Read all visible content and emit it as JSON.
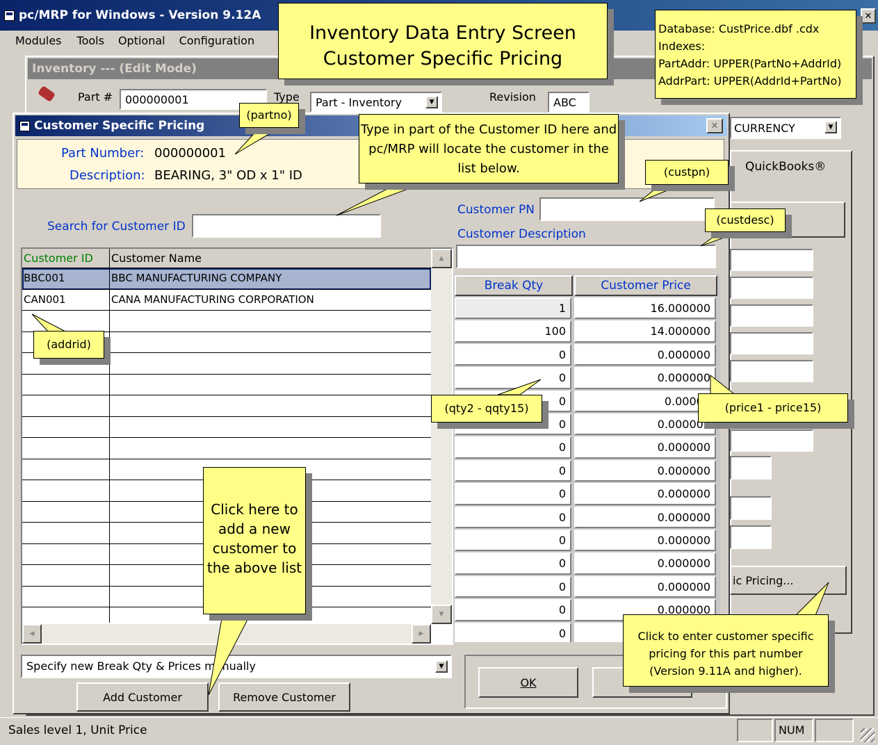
{
  "window": {
    "title": "pc/MRP for Windows - Version 9.12A"
  },
  "menu": [
    "Modules",
    "Tools",
    "Optional",
    "Configuration"
  ],
  "inventory": {
    "title": "Inventory --- (Edit Mode)",
    "part_label": "Part #",
    "part_value": "000000001",
    "type_label": "Type",
    "type_value": "Part - Inventory",
    "revision_label": "Revision",
    "revision_value": "ABC",
    "currency_value": "CURRENCY",
    "quickbooks_tab": "QuickBooks®",
    "pricing_button": "ic Pricing..."
  },
  "dialog": {
    "title": "Customer Specific Pricing",
    "part_number_label": "Part Number:",
    "part_number_value": "000000001",
    "description_label": "Description:",
    "description_value": "BEARING, 3\" OD x 1\" ID",
    "search_label": "Search for Customer ID",
    "search_value": "",
    "customer_pn_label": "Customer PN",
    "customer_pn_value": "",
    "customer_desc_label": "Customer Description",
    "customer_desc_value": "",
    "grid_headers": [
      "Customer ID",
      "Customer Name"
    ],
    "customers": [
      {
        "id": "BBC001",
        "name": "BBC MANUFACTURING COMPANY"
      },
      {
        "id": "CAN001",
        "name": "CANA MANUFACTURING CORPORATION"
      }
    ],
    "price_headers": [
      "Break Qty",
      "Customer Price"
    ],
    "price_rows": [
      {
        "qty": "1",
        "price": "16.000000"
      },
      {
        "qty": "100",
        "price": "14.000000"
      },
      {
        "qty": "0",
        "price": "0.000000"
      },
      {
        "qty": "0",
        "price": "0.000000"
      },
      {
        "qty": "0",
        "price": "0.00000"
      },
      {
        "qty": "0",
        "price": "0.000000"
      },
      {
        "qty": "0",
        "price": "0.000000"
      },
      {
        "qty": "0",
        "price": "0.000000"
      },
      {
        "qty": "0",
        "price": "0.000000"
      },
      {
        "qty": "0",
        "price": "0.000000"
      },
      {
        "qty": "0",
        "price": "0.000000"
      },
      {
        "qty": "0",
        "price": "0.000000"
      },
      {
        "qty": "0",
        "price": "0.000000"
      },
      {
        "qty": "0",
        "price": "0.000000"
      },
      {
        "qty": "0",
        "price": ""
      }
    ],
    "mode_select": "Specify new Break Qty & Prices manually",
    "add_button": "Add Customer",
    "remove_button": "Remove Customer",
    "ok_button": "OK"
  },
  "status": {
    "text": "Sales level 1, Unit Price",
    "num": "NUM"
  },
  "callouts": {
    "header_line1": "Inventory Data Entry Screen",
    "header_line2": "Customer Specific Pricing",
    "database": [
      "Database: CustPrice.dbf .cdx",
      "Indexes:",
      "PartAddr: UPPER(PartNo+AddrId)",
      "AddrPart: UPPER(AddrId+PartNo)"
    ],
    "partno": "(partno)",
    "search": "Type in part of the Customer ID here and pc/MRP will locate the customer in the list below.",
    "custpn": "(custpn)",
    "custdesc": "(custdesc)",
    "addrid": "(addrid)",
    "qty": "(qty2 - qqty15)",
    "price": "(price1 - price15)",
    "add": "Click here to add a new customer to the above list",
    "pricing": "Click to enter customer specific pricing for this part number (Version 9.11A and higher)."
  },
  "colors": {
    "titlebar": "#0a246a",
    "callout": "#ffff88",
    "label_blue": "#0033cc",
    "selected_row": "#a6b4d0"
  }
}
